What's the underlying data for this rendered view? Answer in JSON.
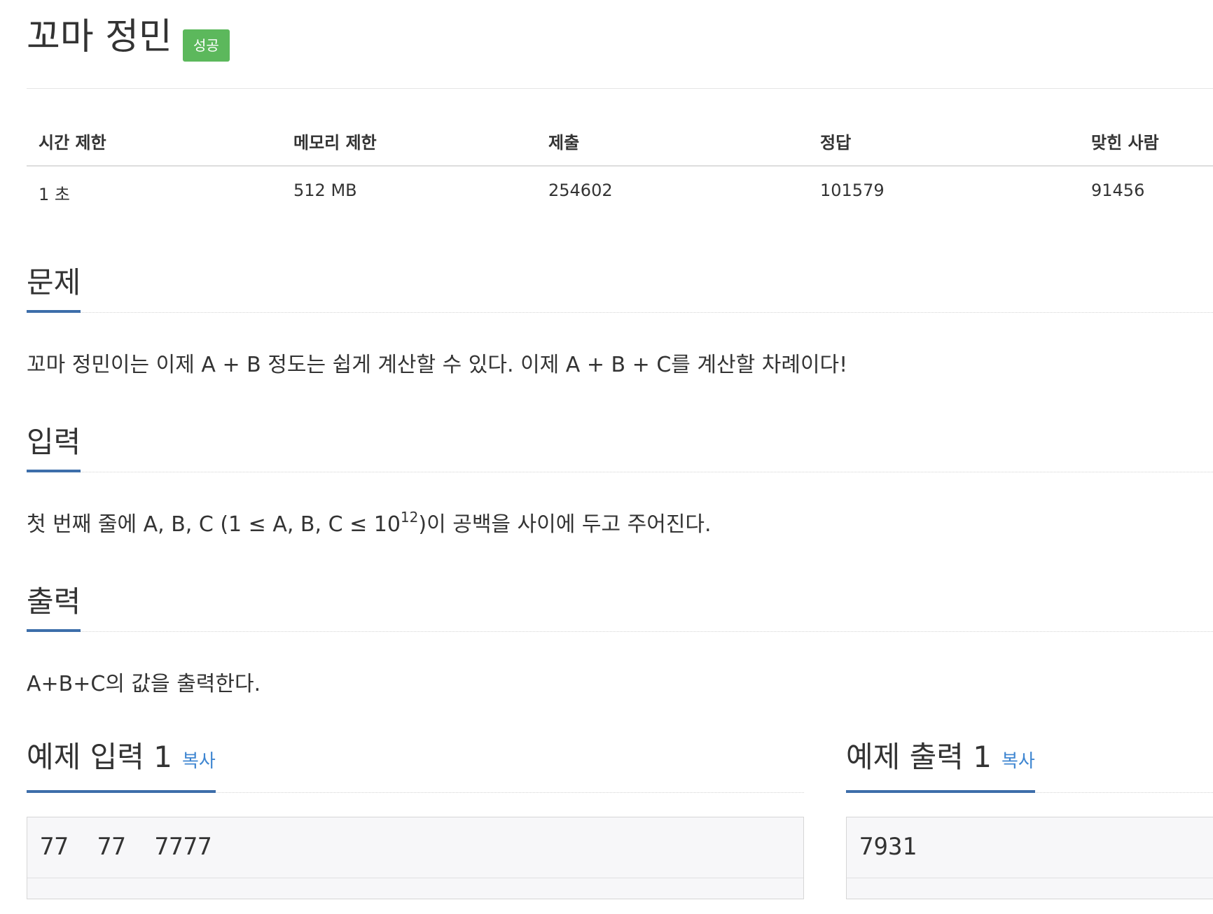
{
  "problem": {
    "title": "꼬마 정민",
    "badge": "성공"
  },
  "info_table": {
    "headers": [
      "시간 제한",
      "메모리 제한",
      "제출",
      "정답",
      "맞힌 사람"
    ],
    "values": [
      "1 초",
      "512 MB",
      "254602",
      "101579",
      "91456"
    ]
  },
  "sections": {
    "description": {
      "title": "문제",
      "text": "꼬마 정민이는 이제 A + B 정도는 쉽게 계산할 수 있다. 이제 A + B + C를 계산할 차례이다!"
    },
    "input": {
      "title": "입력",
      "text_before": "첫 번째 줄에 A, B, C (1 ≤ A, B, C ≤ 10",
      "text_sup": "12",
      "text_after": ")이 공백을 사이에 두고 주어진다."
    },
    "output": {
      "title": "출력",
      "text": "A+B+C의 값을 출력한다."
    }
  },
  "samples": {
    "input": {
      "title": "예제 입력 1",
      "copy_label": "복사",
      "content": "77  77  7777"
    },
    "output": {
      "title": "예제 출력 1",
      "copy_label": "복사",
      "content": "7931"
    }
  },
  "colors": {
    "badge_success": "#5cb85c",
    "section_underline": "#3d6eaa",
    "copy_link": "#3f86d1",
    "sample_bg": "#f7f7f9"
  }
}
